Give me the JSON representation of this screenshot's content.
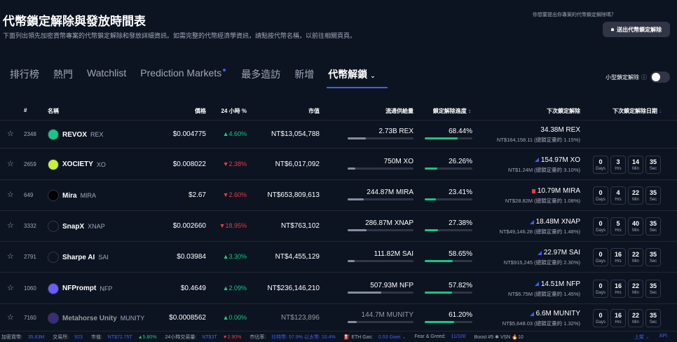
{
  "page": {
    "title": "代幣鎖定解除與發放時間表",
    "description": "下面列出領先加密貨幣專案的代幣鎖定解除和發放詳細資訊。如需完整的代幣經濟學資訊，請點按代幣名稱，以前往相關頁頁。",
    "ask_text": "你想要提出你專案的代幣鎖定解除嗎？",
    "submit_label": "送出代幣鎖定解除"
  },
  "tabs": [
    {
      "label": "排行榜"
    },
    {
      "label": "熱門"
    },
    {
      "label": "Watchlist"
    },
    {
      "label": "Prediction Markets"
    },
    {
      "label": "最多造訪"
    },
    {
      "label": "新增"
    },
    {
      "label": "代幣解鎖"
    }
  ],
  "small_unlock": {
    "label": "小型鎖定解除",
    "info": "ⓘ"
  },
  "headers": {
    "rank": "#",
    "name": "名稱",
    "price": "價格",
    "change": "24 小時 %",
    "mcap": "市值",
    "supply": "流通供給量",
    "progress": "鎖定解除進度",
    "next_unlock": "下次鎖定解除",
    "next_date": "下次鎖定解除日期"
  },
  "countdown_units": {
    "days": "Days",
    "hrs": "Hrs",
    "min": "Min",
    "sec": "Sec"
  },
  "rows": [
    {
      "rank": "2348",
      "name": "REVOX",
      "symbol": "REX",
      "icon": "revox-icon",
      "icon_color": "#16c784",
      "price": "$0.004775",
      "change": "▲4.60%",
      "dir": "up",
      "mcap": "NT$13,054,788",
      "supply": "2.73B REX",
      "supply_pct": 0.28,
      "progress": "68.44%",
      "progress_pct": 0.6844,
      "next_amt": "34.38M REX",
      "next_sub": "NT$164,158.11 (總鎖定量的 1.15%)",
      "marker": "none",
      "cd": null
    },
    {
      "rank": "2659",
      "name": "XOCIETY",
      "symbol": "XO",
      "icon": "xociety-icon",
      "icon_color": "#c6f432",
      "price": "$0.008022",
      "change": "▼2.38%",
      "dir": "down",
      "mcap": "NT$6,017,092",
      "supply": "750M XO",
      "supply_pct": 0.12,
      "progress": "26.26%",
      "progress_pct": 0.2626,
      "next_amt": "154.97M XO",
      "next_sub": "NT$1.24M (總鎖定量的 3.10%)",
      "marker": "tri",
      "cd": [
        "0",
        "3",
        "14",
        "35"
      ]
    },
    {
      "rank": "649",
      "name": "Mira",
      "symbol": "MIRA",
      "icon": "mira-icon",
      "icon_color": "#000000",
      "price": "$2.67",
      "change": "▼2.60%",
      "dir": "down",
      "mcap": "NT$653,809,613",
      "supply": "244.87M MIRA",
      "supply_pct": 0.24,
      "progress": "23.41%",
      "progress_pct": 0.2341,
      "next_amt": "10.79M MIRA",
      "next_sub": "NT$28.82M (總鎖定量的 1.08%)",
      "marker": "sq",
      "cd": [
        "0",
        "4",
        "22",
        "35"
      ]
    },
    {
      "rank": "3332",
      "name": "SnapX",
      "symbol": "XNAP",
      "icon": "snapx-icon",
      "icon_color": "#0d1421",
      "price": "$0.002660",
      "change": "▼18.95%",
      "dir": "down",
      "mcap": "NT$763,102",
      "supply": "286.87M XNAP",
      "supply_pct": 0.29,
      "progress": "27.38%",
      "progress_pct": 0.2738,
      "next_amt": "18.48M XNAP",
      "next_sub": "NT$49,146.28 (總鎖定量的 1.48%)",
      "marker": "tri",
      "cd": [
        "0",
        "5",
        "40",
        "35"
      ]
    },
    {
      "rank": "2791",
      "name": "Sharpe AI",
      "symbol": "SAI",
      "icon": "sharpe-icon",
      "icon_color": "#0d1421",
      "price": "$0.03984",
      "change": "▲3.30%",
      "dir": "up",
      "mcap": "NT$4,455,129",
      "supply": "111.82M SAI",
      "supply_pct": 0.11,
      "progress": "58.65%",
      "progress_pct": 0.5865,
      "next_amt": "22.97M SAI",
      "next_sub": "NT$915,245 (總鎖定量的 2.30%)",
      "marker": "tri",
      "cd": [
        "0",
        "16",
        "22",
        "35"
      ]
    },
    {
      "rank": "1060",
      "name": "NFPrompt",
      "symbol": "NFP",
      "icon": "nfprompt-icon",
      "icon_color": "#6a5cff",
      "price": "$0.4649",
      "change": "▲2.09%",
      "dir": "up",
      "mcap": "NT$236,146,210",
      "supply": "507.93M NFP",
      "supply_pct": 0.51,
      "progress": "57.82%",
      "progress_pct": 0.5782,
      "next_amt": "14.51M NFP",
      "next_sub": "NT$6.75M (總鎖定量的 1.45%)",
      "marker": "tri",
      "cd": [
        "0",
        "16",
        "22",
        "35"
      ]
    },
    {
      "rank": "7160",
      "name": "Metahorse Unity",
      "symbol": "MUNITY",
      "icon": "metahorse-icon",
      "icon_color": "#3b2c7a",
      "price": "$0.0008562",
      "change": "▲0.00%",
      "dir": "up",
      "mcap": "NT$123,896",
      "supply": "144.7M MUNITY",
      "supply_pct": 0.14,
      "progress": "61.20%",
      "progress_pct": 0.612,
      "next_amt": "6.6M MUNITY",
      "next_sub": "NT$5,648.03 (總鎖定量的 1.32%)",
      "marker": "tri",
      "cd": [
        "0",
        "16",
        "22",
        "35"
      ],
      "faded": true
    }
  ],
  "status_bar": {
    "coins_label": "加密貨幣:",
    "coins": "35.63M",
    "exchanges_label": "交易所:",
    "exchanges": "923",
    "mcap_label": "市值:",
    "mcap": "NT$72.75T",
    "mcap_chg": "▲5.80%",
    "vol_label": "24小時交易量:",
    "vol": "NT$3T",
    "vol_chg": "▼2.90%",
    "dom_label": "市佔率:",
    "dom": "比特幣: 57.9% 以太幣: 10.4%",
    "gas_label": "⛽ ETH Gas:",
    "gas": "0.53 Gwei ⌄",
    "fg_label": "Fear & Greed:",
    "fg": "11/100",
    "boost": "Boost #5 ✱ VSN 🔥10",
    "top": "上架 ⌄",
    "api": "API"
  }
}
